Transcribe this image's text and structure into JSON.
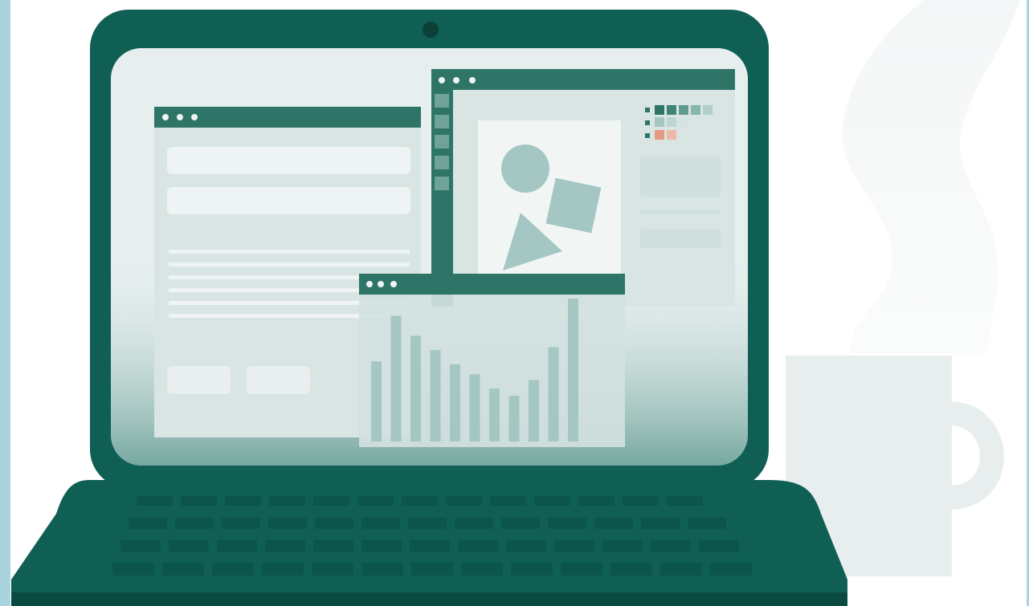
{
  "illustration": {
    "subject": "laptop-with-app-windows-and-coffee-mug",
    "palette": {
      "laptop": "#0f5f54",
      "laptop_dark": "#0b4a41",
      "screen": "#e6efee",
      "window_bar": "#2e7567",
      "window_body": "#dbe7e5",
      "field": "#eef4f3",
      "shape": "#a4c7c3",
      "accent_orange": "#e79a83",
      "mug": "#e8eeee",
      "background_accent": "#a9d3df"
    },
    "icons": [
      "camera-icon",
      "window-dots-icon",
      "circle-shape-icon",
      "square-shape-icon",
      "triangle-shape-icon",
      "coffee-mug-icon",
      "steam-icon"
    ],
    "chart_bars": [
      0.56,
      0.88,
      0.74,
      0.64,
      0.54,
      0.47,
      0.37,
      0.32,
      0.43,
      0.66,
      1.0
    ]
  }
}
